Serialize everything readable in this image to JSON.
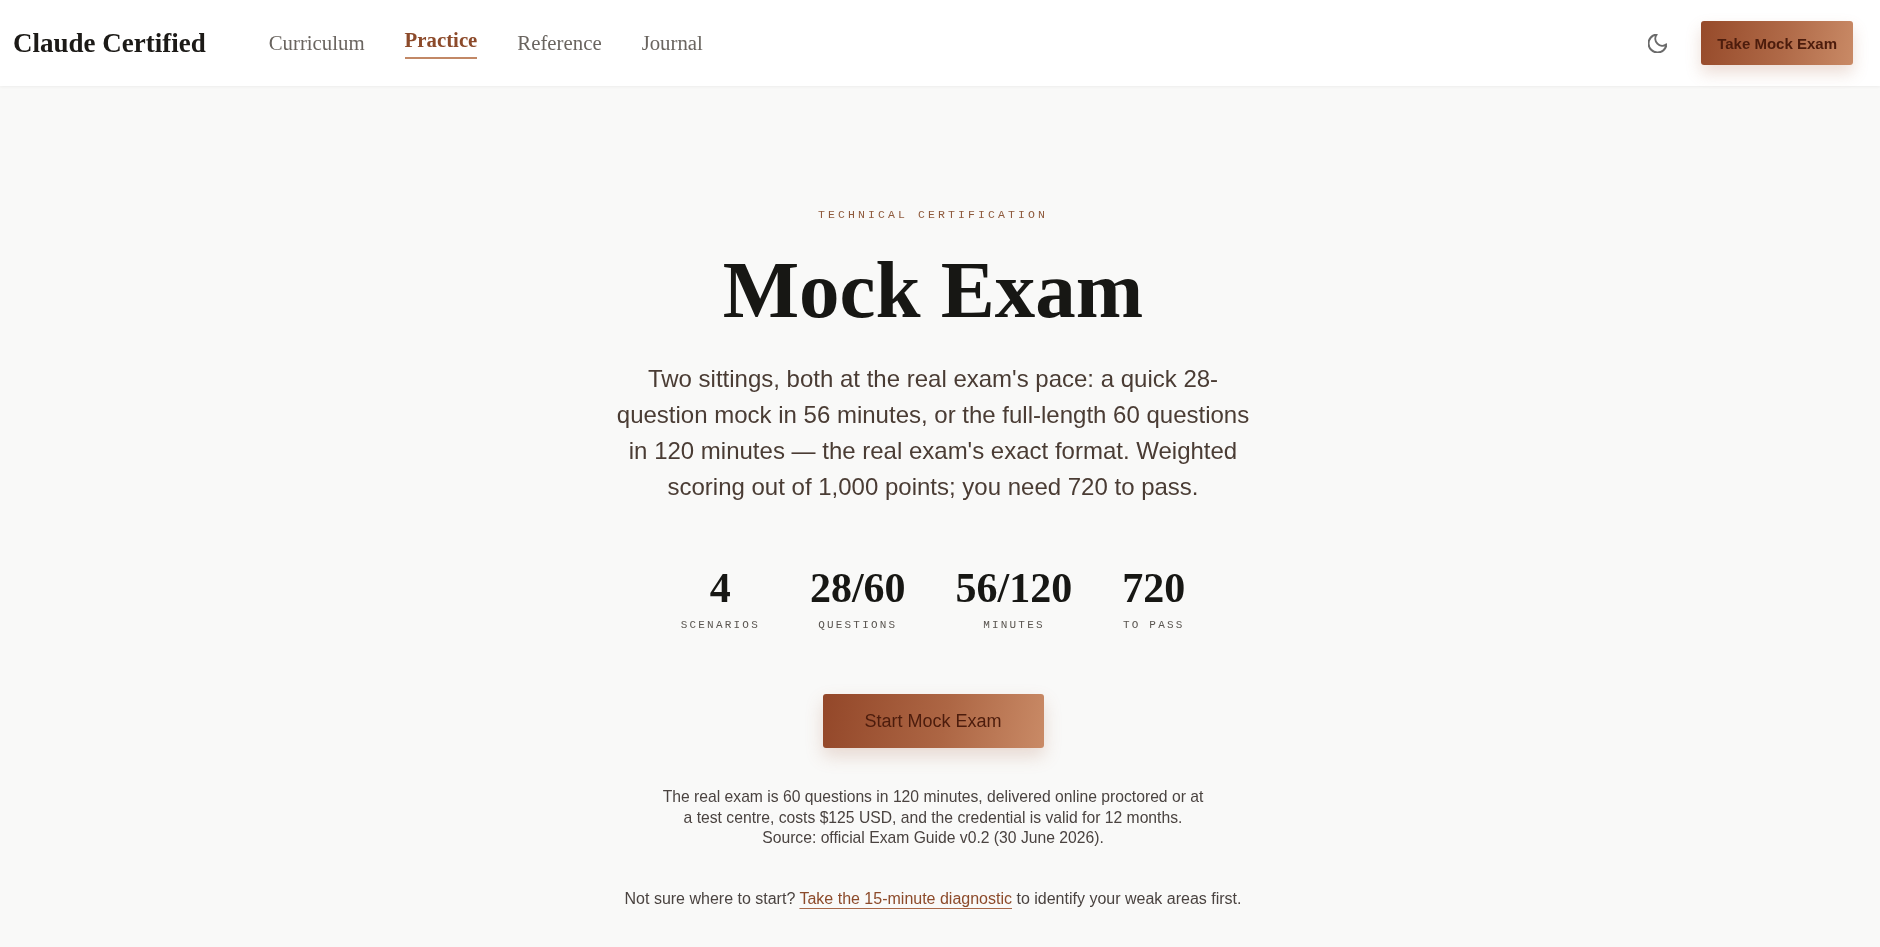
{
  "header": {
    "logo": "Claude Certified",
    "nav": [
      {
        "label": "Curriculum",
        "selected": false
      },
      {
        "label": "Practice",
        "selected": true
      },
      {
        "label": "Reference",
        "selected": false
      },
      {
        "label": "Journal",
        "selected": false
      }
    ],
    "cta": "Take Mock Exam"
  },
  "hero": {
    "eyebrow": "TECHNICAL CERTIFICATION",
    "title": "Mock Exam",
    "intro": "Two sittings, both at the real exam's pace: a quick 28-question mock in 56 minutes, or the full-length 60 questions in 120 minutes — the real exam's exact format. Weighted scoring out of 1,000 points; you need 720 to pass.",
    "stats": [
      {
        "value": "4",
        "label": "SCENARIOS"
      },
      {
        "value": "28/60",
        "label": "QUESTIONS"
      },
      {
        "value": "56/120",
        "label": "MINUTES"
      },
      {
        "value": "720",
        "label": "TO PASS"
      }
    ],
    "start_button": "Start Mock Exam",
    "note": "The real exam is 60 questions in 120 minutes, delivered online proctored or at a test centre, costs $125 USD, and the credential is valid for 12 months.",
    "source": "Source: official Exam Guide v0.2 (30 June 2026).",
    "diagnostic": {
      "before": "Not sure where to start?",
      "link": "Take the 15-minute diagnostic",
      "after": "to identify your weak areas first."
    }
  }
}
